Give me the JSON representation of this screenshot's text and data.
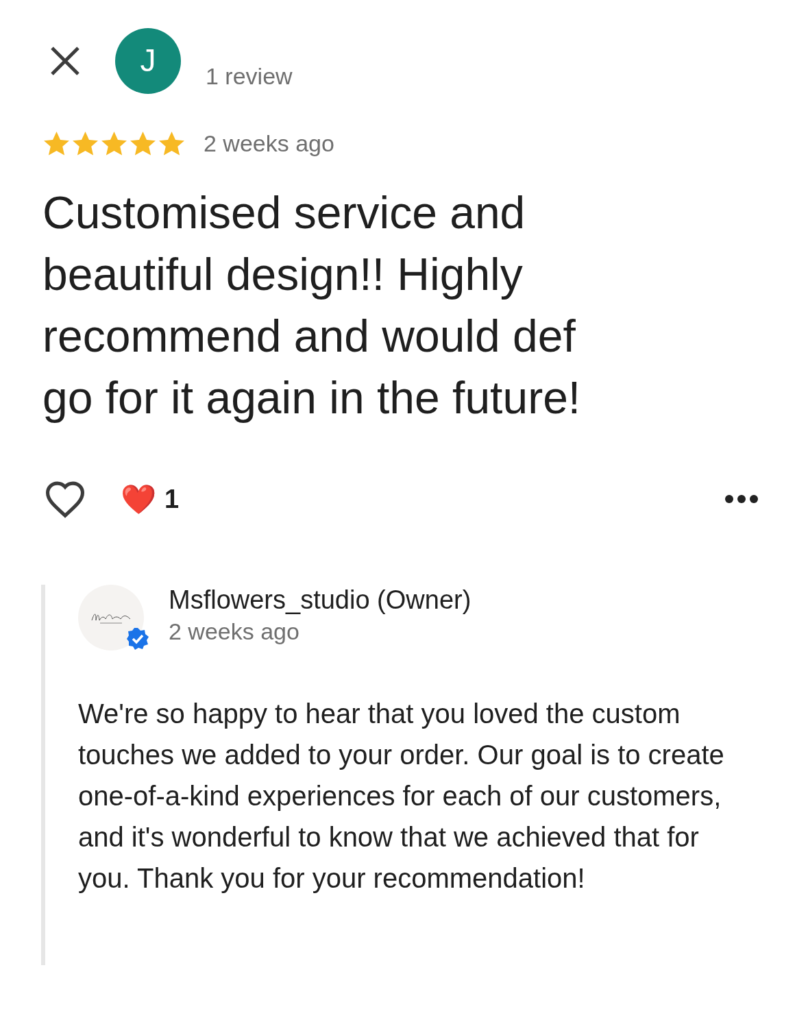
{
  "reviewer": {
    "initial": "J",
    "review_count": "1 review"
  },
  "rating": {
    "stars": 5,
    "time": "2 weeks ago"
  },
  "review_text": "Customised service and beautiful design!! Highly recommend and would def go for it again in the future!",
  "reactions": {
    "liked": false,
    "reaction_emoji": "❤️",
    "reaction_count": "1"
  },
  "owner_reply": {
    "name": "Msflowers_studio (Owner)",
    "verified": true,
    "time": "2 weeks ago",
    "text": "We're so happy to hear that you loved the custom touches we added to your order. Our goal is to create one-of-a-kind experiences for each of our customers, and it's wonderful to know that we achieved that for you. Thank you for your recommendation!"
  }
}
